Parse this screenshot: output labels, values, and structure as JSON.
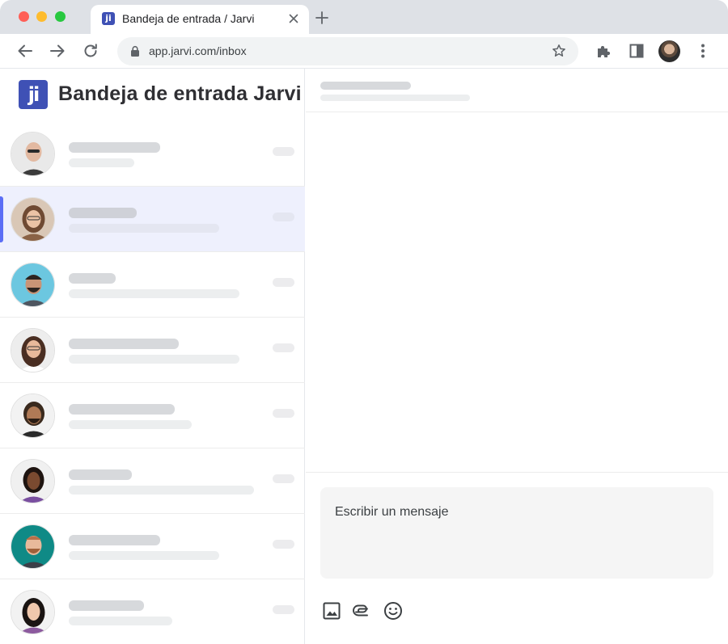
{
  "browser": {
    "tab_title": "Bandeja de entrada / Jarvi",
    "favicon_text": "ji",
    "url": "app.jarvi.com/inbox"
  },
  "app": {
    "logo_text": "ji",
    "title": "Bandeja de entrada Jarvi",
    "accent_color": "#3f51b5"
  },
  "conversations": [
    {
      "active": false
    },
    {
      "active": true
    },
    {
      "active": false
    },
    {
      "active": false
    },
    {
      "active": false
    },
    {
      "active": false
    },
    {
      "active": false
    },
    {
      "active": false
    }
  ],
  "composer": {
    "placeholder": "Escribir un mensaje",
    "tools": [
      "image-icon",
      "attachment-icon",
      "emoji-icon"
    ]
  }
}
